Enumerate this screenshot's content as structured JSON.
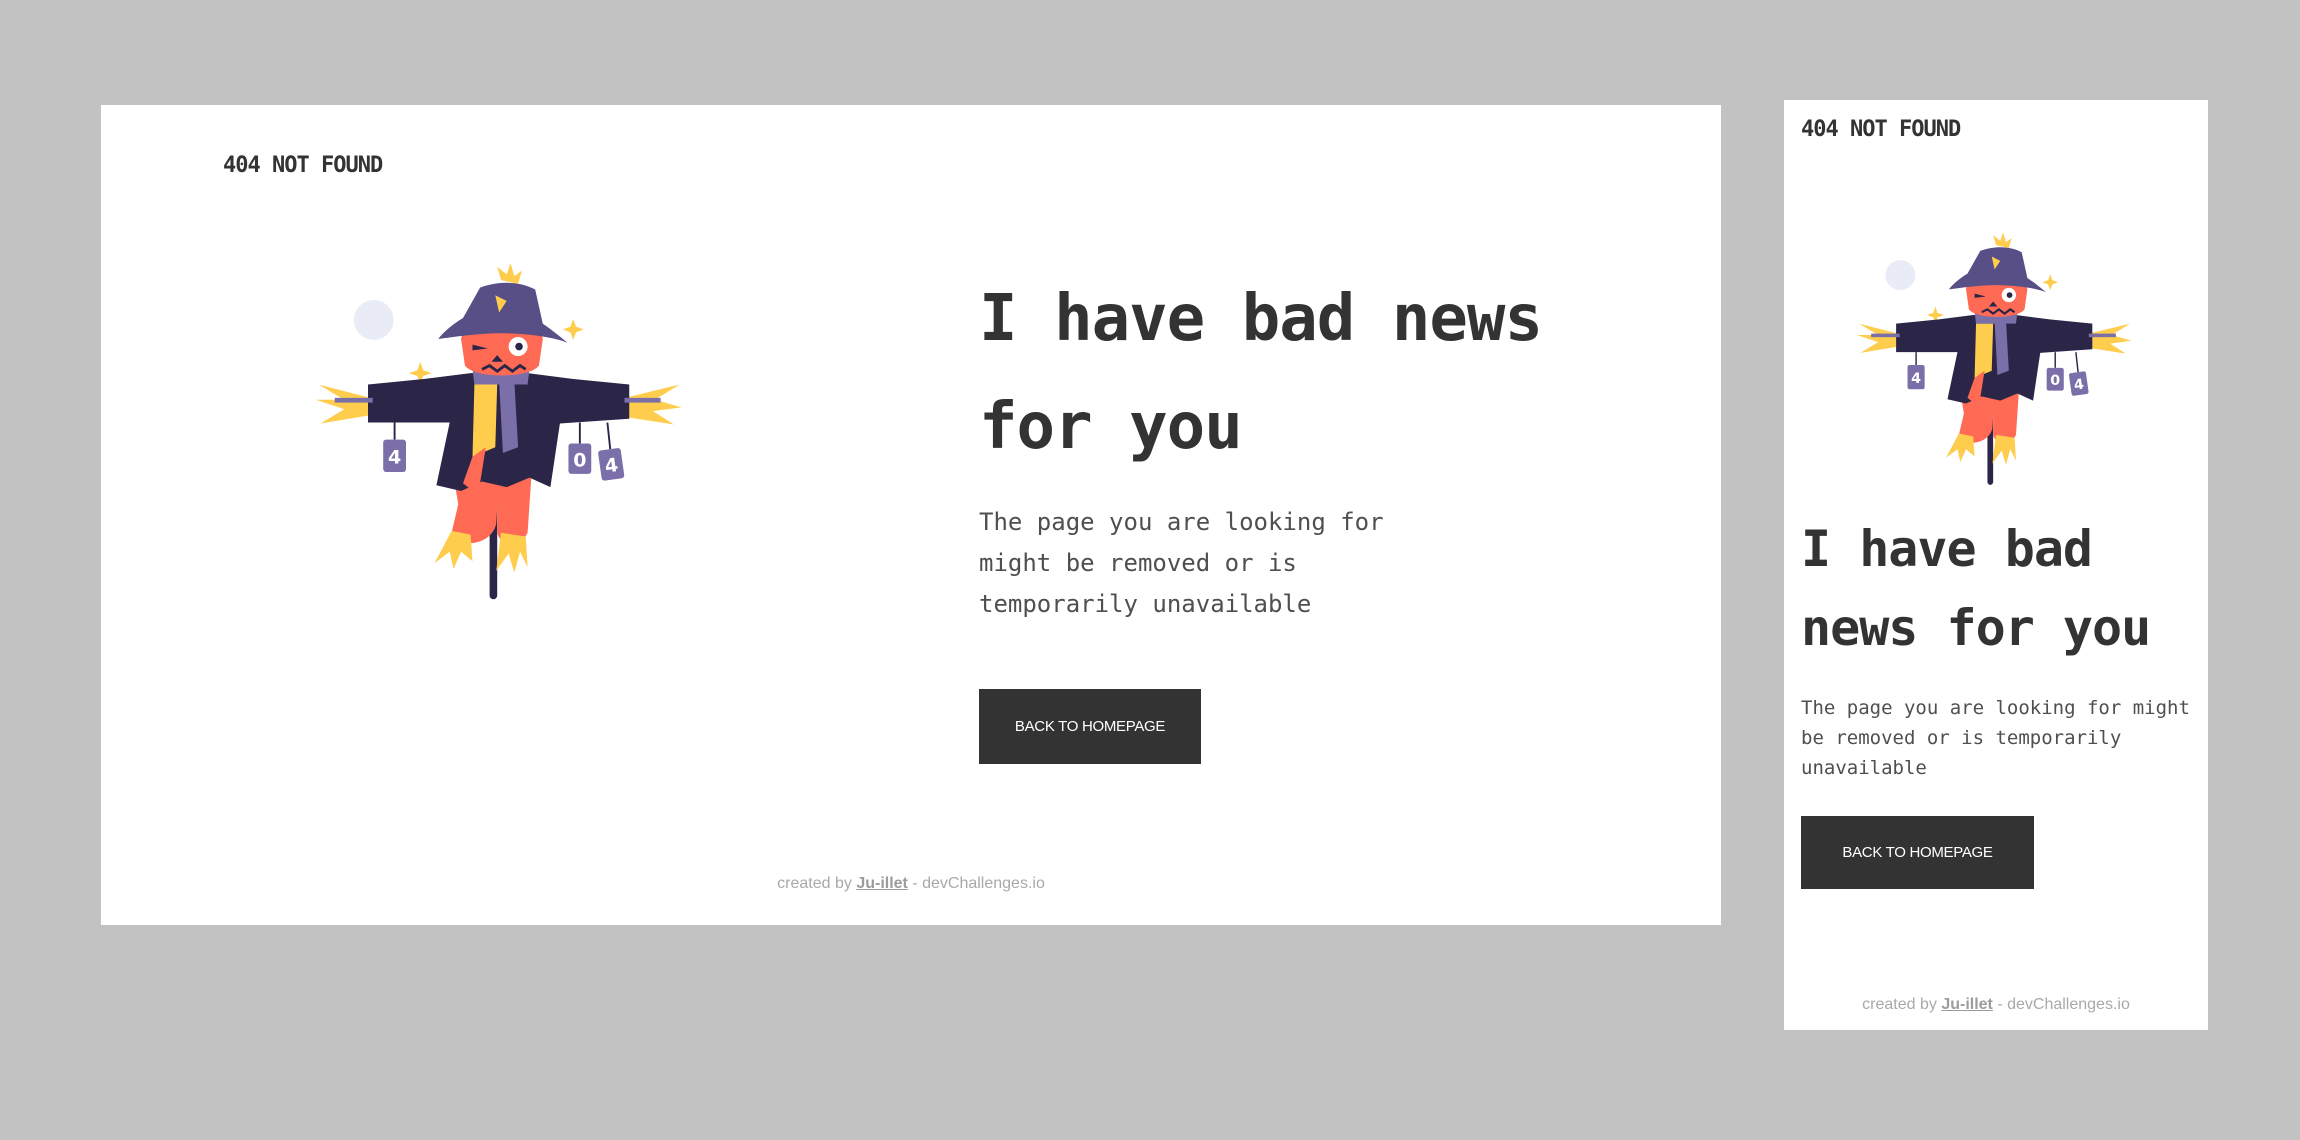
{
  "brand": "404 NOT FOUND",
  "headline": "I have bad news for you",
  "message": "The page you are looking for might be removed or is temporarily unavailable",
  "cta_label": "BACK TO HOMEPAGE",
  "footer": {
    "prefix": "created by",
    "author": "Ju-illet",
    "suffix": "- devChallenges.io"
  },
  "illustration": {
    "subject": "scarecrow",
    "cans": [
      "4",
      "0",
      "4"
    ]
  },
  "colors": {
    "background": "#c2c2c2",
    "panel": "#ffffff",
    "text": "#333333",
    "button": "#333333",
    "button_text": "#ffffff",
    "jacket": "#2b2548",
    "hat": "#574f86",
    "face": "#ff6a55",
    "straw": "#ffcd4d"
  }
}
